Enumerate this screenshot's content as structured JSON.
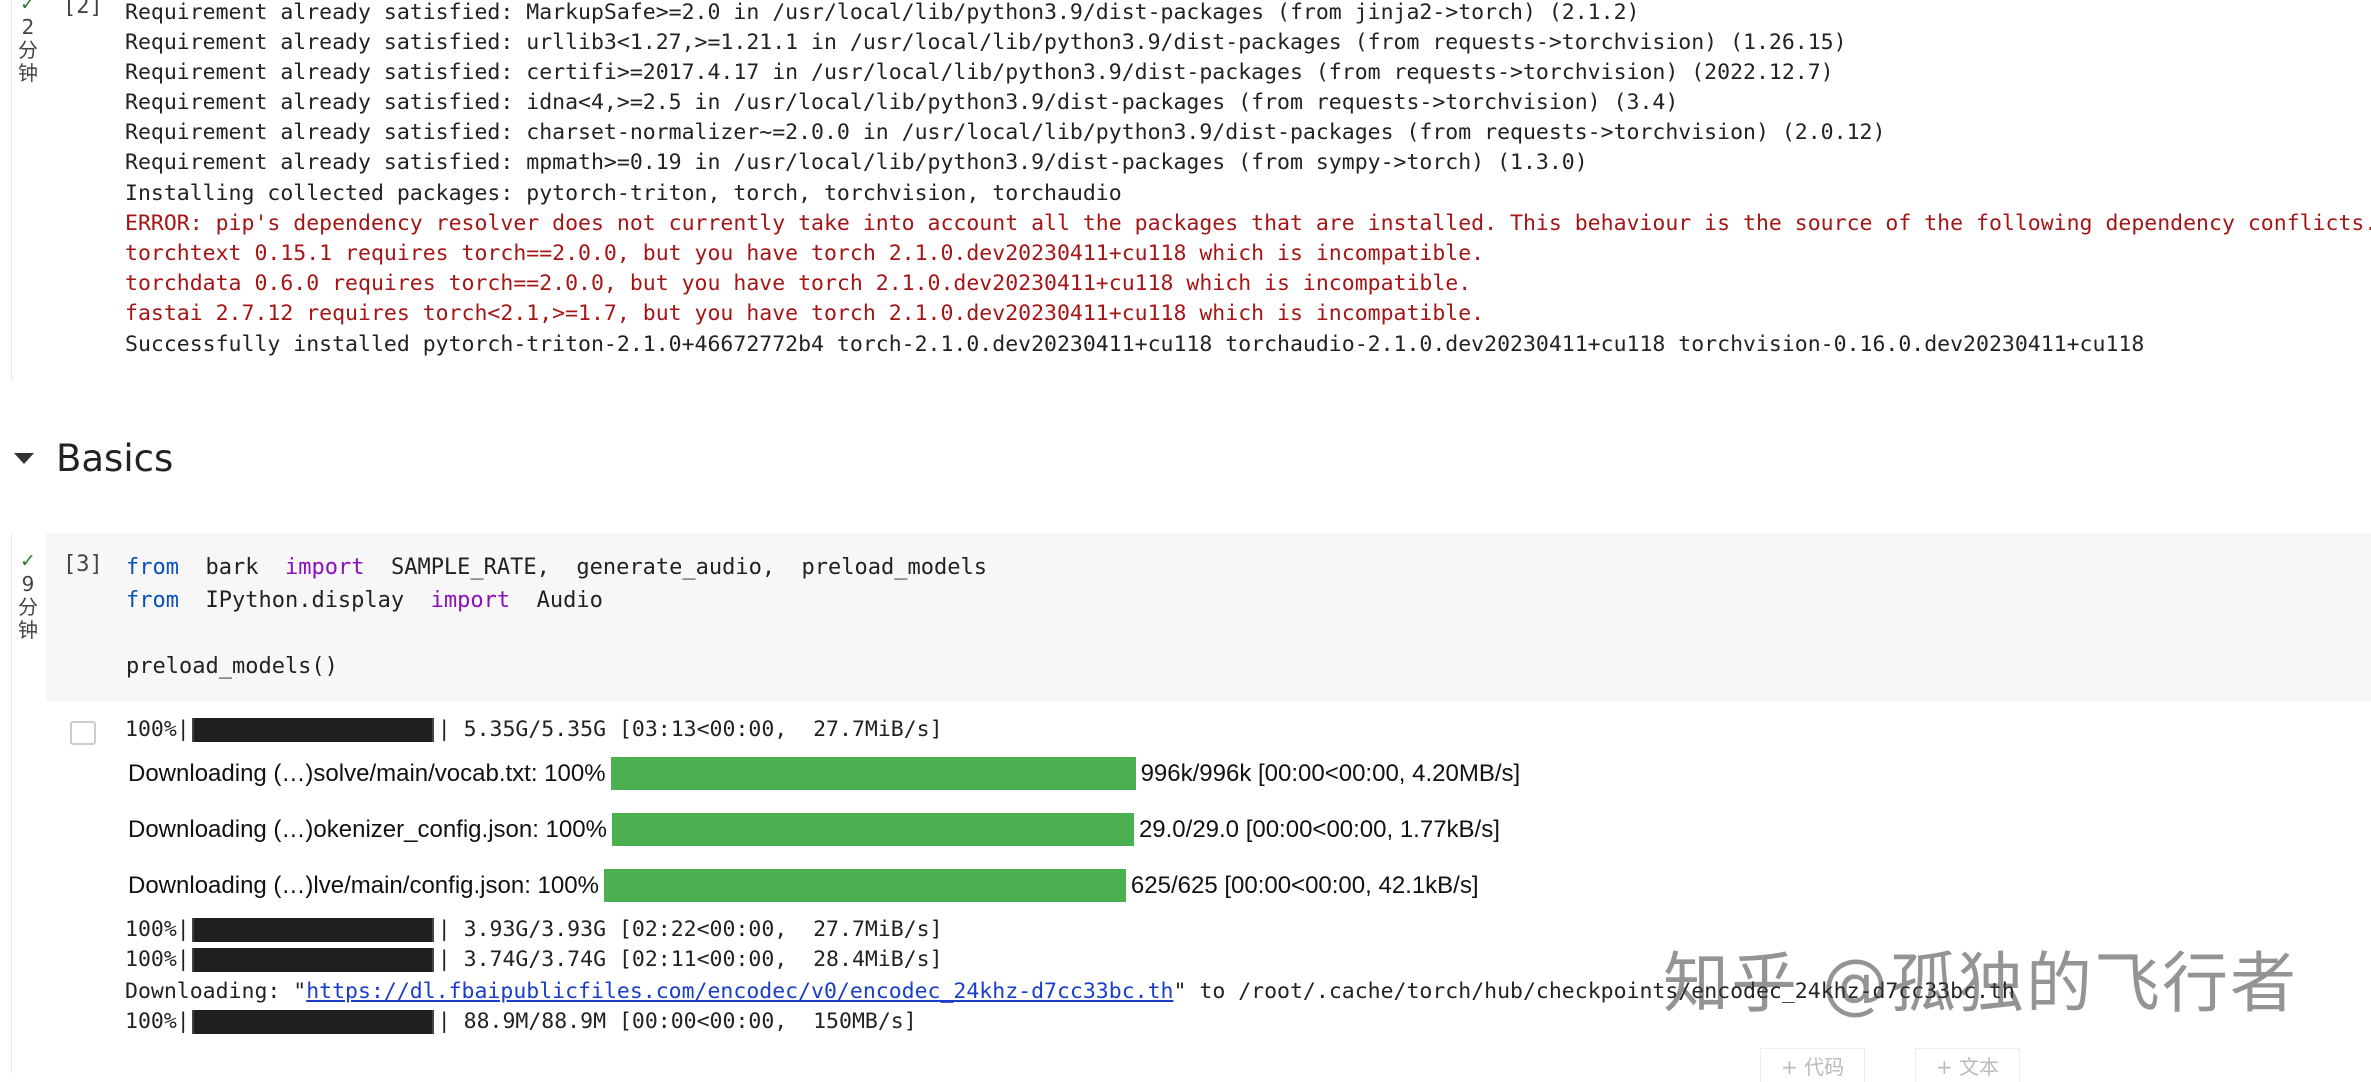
{
  "cell2": {
    "exec_count": "[2]",
    "status_check": "✓",
    "status_time": [
      "2",
      "分",
      "钟"
    ],
    "lines": [
      {
        "text": "Requirement already satisfied: MarkupSafe>=2.0 in /usr/local/lib/python3.9/dist-packages (from jinja2->torch) (2.1.2)",
        "error": false
      },
      {
        "text": "Requirement already satisfied: urllib3<1.27,>=1.21.1 in /usr/local/lib/python3.9/dist-packages (from requests->torchvision) (1.26.15)",
        "error": false
      },
      {
        "text": "Requirement already satisfied: certifi>=2017.4.17 in /usr/local/lib/python3.9/dist-packages (from requests->torchvision) (2022.12.7)",
        "error": false
      },
      {
        "text": "Requirement already satisfied: idna<4,>=2.5 in /usr/local/lib/python3.9/dist-packages (from requests->torchvision) (3.4)",
        "error": false
      },
      {
        "text": "Requirement already satisfied: charset-normalizer~=2.0.0 in /usr/local/lib/python3.9/dist-packages (from requests->torchvision) (2.0.12)",
        "error": false
      },
      {
        "text": "Requirement already satisfied: mpmath>=0.19 in /usr/local/lib/python3.9/dist-packages (from sympy->torch) (1.3.0)",
        "error": false
      },
      {
        "text": "Installing collected packages: pytorch-triton, torch, torchvision, torchaudio",
        "error": false
      },
      {
        "text": "ERROR: pip's dependency resolver does not currently take into account all the packages that are installed. This behaviour is the source of the following dependency conflicts.",
        "error": true
      },
      {
        "text": "torchtext 0.15.1 requires torch==2.0.0, but you have torch 2.1.0.dev20230411+cu118 which is incompatible.",
        "error": true
      },
      {
        "text": "torchdata 0.6.0 requires torch==2.0.0, but you have torch 2.1.0.dev20230411+cu118 which is incompatible.",
        "error": true
      },
      {
        "text": "fastai 2.7.12 requires torch<2.1,>=1.7, but you have torch 2.1.0.dev20230411+cu118 which is incompatible.",
        "error": true
      },
      {
        "text": "Successfully installed pytorch-triton-2.1.0+46672772b4 torch-2.1.0.dev20230411+cu118 torchaudio-2.1.0.dev20230411+cu118 torchvision-0.16.0.dev20230411+cu118",
        "error": false
      }
    ]
  },
  "section": {
    "title": "Basics"
  },
  "cell3": {
    "exec_count": "[3]",
    "status_check": "✓",
    "status_time": [
      "9",
      "分",
      "钟"
    ],
    "code": {
      "line1": {
        "kw_from": "from",
        "module": "bark",
        "kw_import": "import",
        "names": "SAMPLE_RATE,  generate_audio,  preload_models"
      },
      "line2": {
        "kw_from": "from",
        "module": "IPython.display",
        "kw_import": "import",
        "names": "Audio"
      },
      "line3": "preload_models()"
    },
    "outputs": {
      "pbar1": {
        "pct": "100%|",
        "tail": "| 5.35G/5.35G [03:13<00:00,  27.7MiB/s]",
        "fraction": 1.0
      },
      "dl1": {
        "label": "Downloading (…)solve/main/vocab.txt: 100%",
        "stats": "996k/996k [00:00<00:00, 4.20MB/s]",
        "fraction": 1.0
      },
      "dl2": {
        "label": "Downloading (…)okenizer_config.json: 100%",
        "stats": "29.0/29.0 [00:00<00:00, 1.77kB/s]",
        "fraction": 1.0
      },
      "dl3": {
        "label": "Downloading (…)lve/main/config.json: 100%",
        "stats": "625/625 [00:00<00:00, 42.1kB/s]",
        "fraction": 1.0
      },
      "pbar2": {
        "pct": "100%|",
        "tail": "| 3.93G/3.93G [02:22<00:00,  27.7MiB/s]",
        "fraction": 1.0
      },
      "pbar3": {
        "pct": "100%|",
        "tail": "| 3.74G/3.74G [02:11<00:00,  28.4MiB/s]",
        "fraction": 1.0
      },
      "download_prefix": "Downloading: \"",
      "download_url": "https://dl.fbaipublicfiles.com/encodec/v0/encodec_24khz-d7cc33bc.th",
      "download_suffix": "\" to /root/.cache/torch/hub/checkpoints/encodec_24khz-d7cc33bc.th",
      "pbar4": {
        "pct": "100%|",
        "tail": "| 88.9M/88.9M [00:00<00:00,  150MB/s]",
        "fraction": 1.0
      }
    }
  },
  "watermark": "知乎 @孤独的飞行者",
  "add_code": "+ 代码",
  "add_text": "+ 文本",
  "colors": {
    "success": "#2e7d32",
    "error": "#a51515",
    "keyword": "#8b0fbf",
    "progress": "#4caf50",
    "link": "#1a3ec9"
  }
}
